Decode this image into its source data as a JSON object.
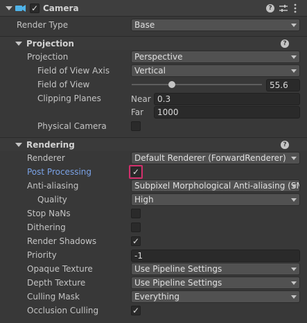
{
  "component": {
    "title": "Camera",
    "enabled_check": "✓",
    "icons": [
      "camera-icon",
      "help-icon",
      "settings-sliders-icon",
      "more-icon"
    ]
  },
  "render_type": {
    "label": "Render Type",
    "value": "Base"
  },
  "projection_section": {
    "title": "Projection",
    "projection": {
      "label": "Projection",
      "value": "Perspective"
    },
    "fov_axis": {
      "label": "Field of View Axis",
      "value": "Vertical"
    },
    "fov": {
      "label": "Field of View",
      "value": "55.6",
      "slider_fraction": 0.3
    },
    "clipping": {
      "label": "Clipping Planes",
      "near_label": "Near",
      "near_value": "0.3",
      "far_label": "Far",
      "far_value": "1000"
    },
    "physical_camera": {
      "label": "Physical Camera",
      "checked": ""
    }
  },
  "rendering_section": {
    "title": "Rendering",
    "renderer": {
      "label": "Renderer",
      "value": "Default Renderer (ForwardRenderer)"
    },
    "post_processing": {
      "label": "Post Processing",
      "checked": "✓"
    },
    "anti_aliasing": {
      "label": "Anti-aliasing",
      "value": "Subpixel Morphological Anti-aliasing (SM"
    },
    "quality": {
      "label": "Quality",
      "value": "High"
    },
    "stop_nans": {
      "label": "Stop NaNs",
      "checked": ""
    },
    "dithering": {
      "label": "Dithering",
      "checked": ""
    },
    "render_shadows": {
      "label": "Render Shadows",
      "checked": "✓"
    },
    "priority": {
      "label": "Priority",
      "value": "-1"
    },
    "opaque_texture": {
      "label": "Opaque Texture",
      "value": "Use Pipeline Settings"
    },
    "depth_texture": {
      "label": "Depth Texture",
      "value": "Use Pipeline Settings"
    },
    "culling_mask": {
      "label": "Culling Mask",
      "value": "Everything"
    },
    "occlusion_culling": {
      "label": "Occlusion Culling",
      "checked": "✓"
    }
  },
  "colors": {
    "background": "#383838",
    "link": "#7aa2e6",
    "highlight": "#d02e6a",
    "accent_icon": "#4fb3e8"
  }
}
